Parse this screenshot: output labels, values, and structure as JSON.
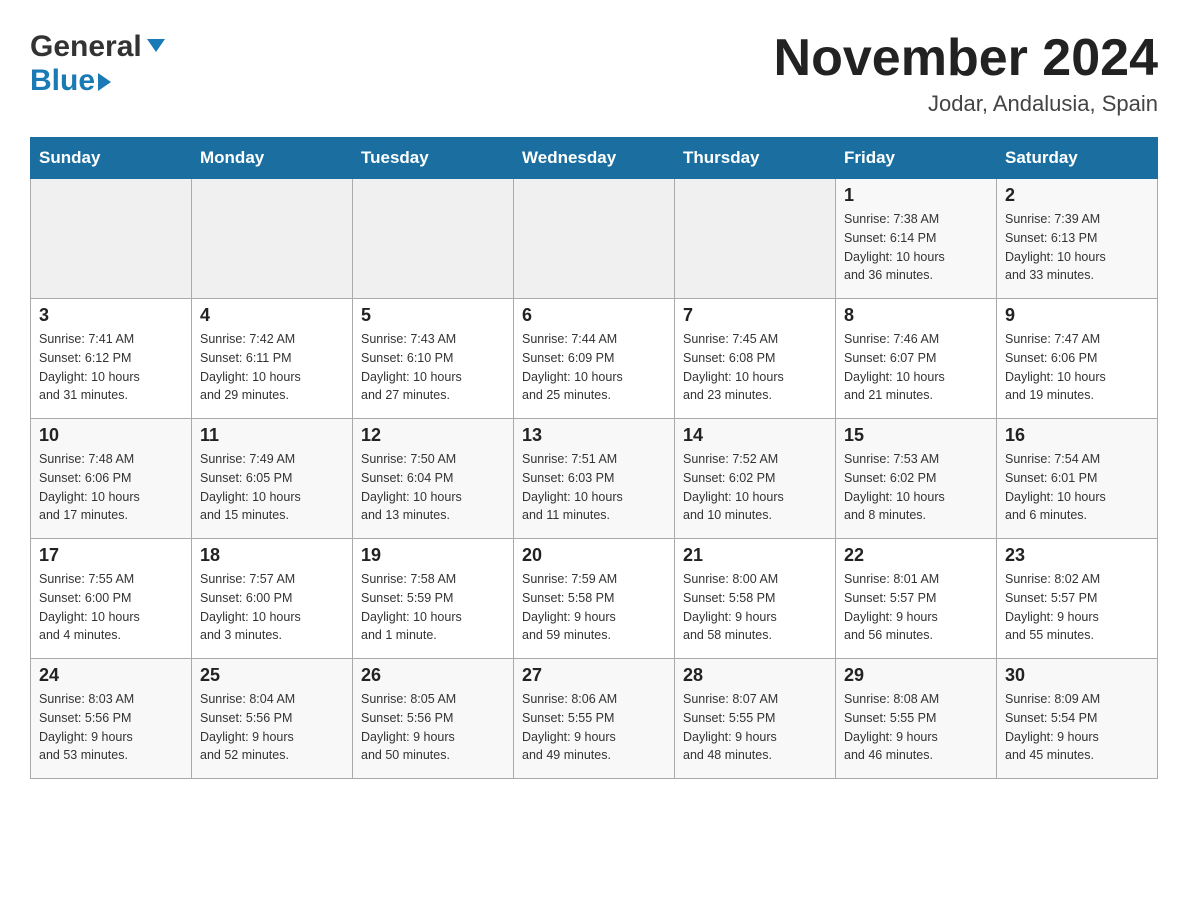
{
  "header": {
    "logo_general": "General",
    "logo_blue": "Blue",
    "title": "November 2024",
    "subtitle": "Jodar, Andalusia, Spain"
  },
  "weekdays": [
    "Sunday",
    "Monday",
    "Tuesday",
    "Wednesday",
    "Thursday",
    "Friday",
    "Saturday"
  ],
  "weeks": [
    [
      {
        "day": "",
        "info": ""
      },
      {
        "day": "",
        "info": ""
      },
      {
        "day": "",
        "info": ""
      },
      {
        "day": "",
        "info": ""
      },
      {
        "day": "",
        "info": ""
      },
      {
        "day": "1",
        "info": "Sunrise: 7:38 AM\nSunset: 6:14 PM\nDaylight: 10 hours\nand 36 minutes."
      },
      {
        "day": "2",
        "info": "Sunrise: 7:39 AM\nSunset: 6:13 PM\nDaylight: 10 hours\nand 33 minutes."
      }
    ],
    [
      {
        "day": "3",
        "info": "Sunrise: 7:41 AM\nSunset: 6:12 PM\nDaylight: 10 hours\nand 31 minutes."
      },
      {
        "day": "4",
        "info": "Sunrise: 7:42 AM\nSunset: 6:11 PM\nDaylight: 10 hours\nand 29 minutes."
      },
      {
        "day": "5",
        "info": "Sunrise: 7:43 AM\nSunset: 6:10 PM\nDaylight: 10 hours\nand 27 minutes."
      },
      {
        "day": "6",
        "info": "Sunrise: 7:44 AM\nSunset: 6:09 PM\nDaylight: 10 hours\nand 25 minutes."
      },
      {
        "day": "7",
        "info": "Sunrise: 7:45 AM\nSunset: 6:08 PM\nDaylight: 10 hours\nand 23 minutes."
      },
      {
        "day": "8",
        "info": "Sunrise: 7:46 AM\nSunset: 6:07 PM\nDaylight: 10 hours\nand 21 minutes."
      },
      {
        "day": "9",
        "info": "Sunrise: 7:47 AM\nSunset: 6:06 PM\nDaylight: 10 hours\nand 19 minutes."
      }
    ],
    [
      {
        "day": "10",
        "info": "Sunrise: 7:48 AM\nSunset: 6:06 PM\nDaylight: 10 hours\nand 17 minutes."
      },
      {
        "day": "11",
        "info": "Sunrise: 7:49 AM\nSunset: 6:05 PM\nDaylight: 10 hours\nand 15 minutes."
      },
      {
        "day": "12",
        "info": "Sunrise: 7:50 AM\nSunset: 6:04 PM\nDaylight: 10 hours\nand 13 minutes."
      },
      {
        "day": "13",
        "info": "Sunrise: 7:51 AM\nSunset: 6:03 PM\nDaylight: 10 hours\nand 11 minutes."
      },
      {
        "day": "14",
        "info": "Sunrise: 7:52 AM\nSunset: 6:02 PM\nDaylight: 10 hours\nand 10 minutes."
      },
      {
        "day": "15",
        "info": "Sunrise: 7:53 AM\nSunset: 6:02 PM\nDaylight: 10 hours\nand 8 minutes."
      },
      {
        "day": "16",
        "info": "Sunrise: 7:54 AM\nSunset: 6:01 PM\nDaylight: 10 hours\nand 6 minutes."
      }
    ],
    [
      {
        "day": "17",
        "info": "Sunrise: 7:55 AM\nSunset: 6:00 PM\nDaylight: 10 hours\nand 4 minutes."
      },
      {
        "day": "18",
        "info": "Sunrise: 7:57 AM\nSunset: 6:00 PM\nDaylight: 10 hours\nand 3 minutes."
      },
      {
        "day": "19",
        "info": "Sunrise: 7:58 AM\nSunset: 5:59 PM\nDaylight: 10 hours\nand 1 minute."
      },
      {
        "day": "20",
        "info": "Sunrise: 7:59 AM\nSunset: 5:58 PM\nDaylight: 9 hours\nand 59 minutes."
      },
      {
        "day": "21",
        "info": "Sunrise: 8:00 AM\nSunset: 5:58 PM\nDaylight: 9 hours\nand 58 minutes."
      },
      {
        "day": "22",
        "info": "Sunrise: 8:01 AM\nSunset: 5:57 PM\nDaylight: 9 hours\nand 56 minutes."
      },
      {
        "day": "23",
        "info": "Sunrise: 8:02 AM\nSunset: 5:57 PM\nDaylight: 9 hours\nand 55 minutes."
      }
    ],
    [
      {
        "day": "24",
        "info": "Sunrise: 8:03 AM\nSunset: 5:56 PM\nDaylight: 9 hours\nand 53 minutes."
      },
      {
        "day": "25",
        "info": "Sunrise: 8:04 AM\nSunset: 5:56 PM\nDaylight: 9 hours\nand 52 minutes."
      },
      {
        "day": "26",
        "info": "Sunrise: 8:05 AM\nSunset: 5:56 PM\nDaylight: 9 hours\nand 50 minutes."
      },
      {
        "day": "27",
        "info": "Sunrise: 8:06 AM\nSunset: 5:55 PM\nDaylight: 9 hours\nand 49 minutes."
      },
      {
        "day": "28",
        "info": "Sunrise: 8:07 AM\nSunset: 5:55 PM\nDaylight: 9 hours\nand 48 minutes."
      },
      {
        "day": "29",
        "info": "Sunrise: 8:08 AM\nSunset: 5:55 PM\nDaylight: 9 hours\nand 46 minutes."
      },
      {
        "day": "30",
        "info": "Sunrise: 8:09 AM\nSunset: 5:54 PM\nDaylight: 9 hours\nand 45 minutes."
      }
    ]
  ]
}
